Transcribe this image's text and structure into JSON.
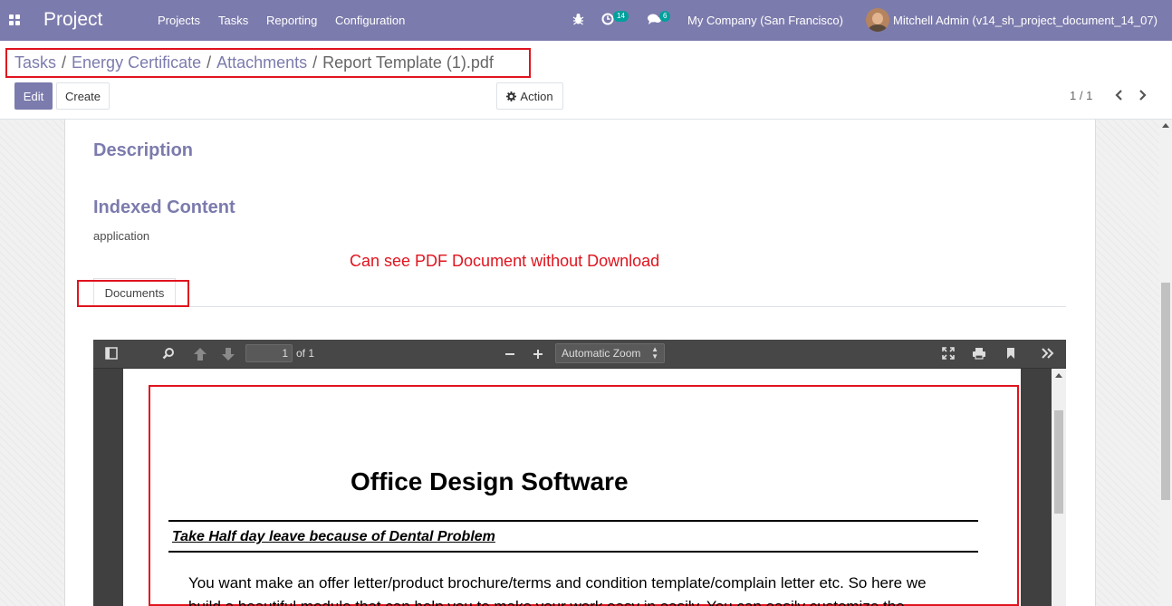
{
  "navbar": {
    "app_name": "Project",
    "menu": [
      "Projects",
      "Tasks",
      "Reporting",
      "Configuration"
    ],
    "activity_count": "14",
    "message_count": "6",
    "company": "My Company (San Francisco)",
    "user": "Mitchell Admin (v14_sh_project_document_14_07)",
    "icons": [
      "apps-icon",
      "bug-icon",
      "clock-icon",
      "chat-icon"
    ]
  },
  "breadcrumb": {
    "items": [
      "Tasks",
      "Energy Certificate",
      "Attachments"
    ],
    "current": "Report Template (1).pdf",
    "separator": "/"
  },
  "buttons": {
    "edit": "Edit",
    "create": "Create",
    "action": "Action"
  },
  "pager": {
    "text": "1 / 1"
  },
  "form": {
    "description_label": "Description",
    "indexed_content_label": "Indexed Content",
    "indexed_content_value": "application",
    "annotation": "Can see PDF Document without Download",
    "tab_label": "Documents"
  },
  "pdf_viewer": {
    "page_number": "1",
    "page_total": "of 1",
    "zoom": "Automatic Zoom"
  },
  "pdf_document": {
    "title": "Office Design Software",
    "heading": "Take Half day leave because of Dental Problem",
    "paragraph_line1": "You want make an offer letter/product brochure/terms and condition template/complain letter etc. So here we",
    "paragraph_line2": "build a beautiful module that can help you to make your work easy in easily. You can easily customize the"
  },
  "colors": {
    "brand": "#7c7bad",
    "annotation_red": "#e0141e",
    "badge_teal": "#00a09d"
  }
}
